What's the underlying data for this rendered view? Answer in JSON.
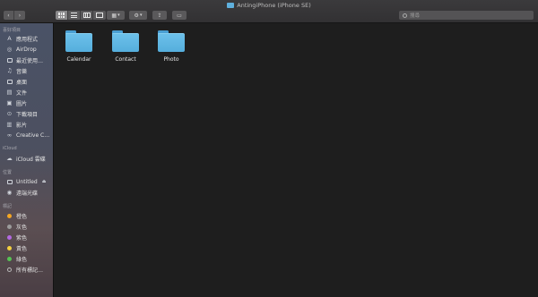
{
  "window": {
    "title": "AntingiPhone (iPhone SE)"
  },
  "toolbar": {
    "back_glyph": "‹",
    "forward_glyph": "›",
    "arrange_glyph": "▦",
    "gear_glyph": "⚙",
    "dropdown_glyph": "▾",
    "share_glyph": "⇪",
    "tag_glyph": "▭",
    "search_placeholder": "搜尋"
  },
  "sidebar": {
    "favorites_header": "喜好項目",
    "favorites": [
      {
        "label": "應用程式",
        "icon": "applications-icon"
      },
      {
        "label": "AirDrop",
        "icon": "airdrop-icon"
      },
      {
        "label": "最近使用…",
        "icon": "recents-icon"
      },
      {
        "label": "音樂",
        "icon": "music-icon"
      },
      {
        "label": "桌面",
        "icon": "desktop-icon"
      },
      {
        "label": "文件",
        "icon": "documents-icon"
      },
      {
        "label": "圖片",
        "icon": "pictures-icon"
      },
      {
        "label": "下載項目",
        "icon": "downloads-icon"
      },
      {
        "label": "影片",
        "icon": "movies-icon"
      },
      {
        "label": "Creative C…",
        "icon": "creative-cloud-icon"
      }
    ],
    "icloud_header": "iCloud",
    "icloud": [
      {
        "label": "iCloud 雲碟",
        "icon": "icloud-icon"
      }
    ],
    "locations_header": "位置",
    "locations": [
      {
        "label": "Untitled",
        "icon": "disk-icon",
        "eject": "⏏"
      },
      {
        "label": "遠端光碟",
        "icon": "remote-disc-icon"
      }
    ],
    "tags_header": "標記",
    "tags": [
      {
        "label": "橙色",
        "color": "#f5a623"
      },
      {
        "label": "灰色",
        "color": "#9b9b9b"
      },
      {
        "label": "紫色",
        "color": "#b36ae2"
      },
      {
        "label": "黃色",
        "color": "#f4d03f"
      },
      {
        "label": "綠色",
        "color": "#56c254"
      },
      {
        "label": "所有標記…",
        "color": ""
      }
    ]
  },
  "main": {
    "folders": [
      {
        "name": "Calendar"
      },
      {
        "name": "Contact"
      },
      {
        "name": "Photo"
      }
    ]
  },
  "colors": {
    "folder": "#5fb4e0",
    "background": "#1e1e1e",
    "toolbar": "#363537"
  }
}
